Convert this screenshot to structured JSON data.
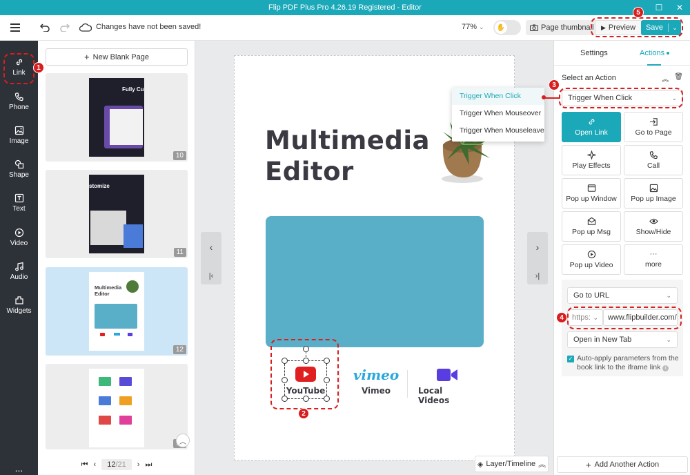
{
  "app": {
    "title": "Flip PDF Plus Pro 4.26.19 Registered - Editor"
  },
  "toolbar": {
    "unsaved_message": "Changes have not been saved!",
    "zoom": "77%",
    "page_thumbnail_label": "Page thumbnail",
    "preview_label": "Preview",
    "save_label": "Save"
  },
  "rail": {
    "items": [
      {
        "label": "Link",
        "icon": "link-icon"
      },
      {
        "label": "Phone",
        "icon": "phone-icon"
      },
      {
        "label": "Image",
        "icon": "image-icon"
      },
      {
        "label": "Shape",
        "icon": "shape-icon"
      },
      {
        "label": "Text",
        "icon": "text-icon"
      },
      {
        "label": "Video",
        "icon": "video-icon"
      },
      {
        "label": "Audio",
        "icon": "audio-icon"
      },
      {
        "label": "Widgets",
        "icon": "widgets-icon"
      }
    ],
    "more": "..."
  },
  "thumbs": {
    "new_page_label": "New Blank Page",
    "pages": [
      {
        "num": "10",
        "heading": "Fully Cu"
      },
      {
        "num": "11",
        "heading": "stomize"
      },
      {
        "num": "12",
        "heading": "Multimedia Editor"
      },
      {
        "num": "13",
        "heading": ""
      }
    ],
    "pager_current": "12",
    "pager_total": "/21"
  },
  "canvas": {
    "title_line1": "Multimedia",
    "title_line2": "Editor",
    "media": [
      {
        "label": "YouTube",
        "icon": "youtube-icon"
      },
      {
        "label": "Vimeo",
        "logo": "vimeo"
      },
      {
        "label": "Local Videos",
        "icon": "video-camera-icon"
      }
    ],
    "layer_timeline_label": "Layer/Timeline"
  },
  "dropdown": {
    "items": [
      "Trigger When Click",
      "Trigger When Mouseover",
      "Trigger When Mouseleave"
    ]
  },
  "panel": {
    "tab_settings": "Settings",
    "tab_actions": "Actions",
    "select_action_label": "Select an Action",
    "trigger_value": "Trigger When Click",
    "actions": [
      {
        "label": "Open Link",
        "icon": "link-icon"
      },
      {
        "label": "Go to Page",
        "icon": "go-to-page-icon"
      },
      {
        "label": "Play Effects",
        "icon": "sparkle-icon"
      },
      {
        "label": "Call",
        "icon": "phone-icon"
      },
      {
        "label": "Pop up Window",
        "icon": "window-icon"
      },
      {
        "label": "Pop up Image",
        "icon": "image-icon"
      },
      {
        "label": "Pop up Msg",
        "icon": "envelope-icon"
      },
      {
        "label": "Show/Hide",
        "icon": "eye-icon"
      },
      {
        "label": "Pop up Video",
        "icon": "play-circle-icon"
      },
      {
        "label": "more",
        "icon": "more-icon"
      }
    ],
    "url_type": "Go to URL",
    "protocol": "https:",
    "url_value": "www.flipbuilder.com/",
    "open_mode": "Open in New Tab",
    "auto_apply_text": "Auto-apply parameters from the book link to the iframe link",
    "add_action_label": "Add Another Action"
  },
  "annotations": [
    "1",
    "2",
    "3",
    "4",
    "5"
  ],
  "colors": {
    "accent": "#1ba8b8",
    "rail_bg": "#2d3138",
    "annotation": "#d81e1e",
    "canvas_block": "#5aafc8"
  }
}
